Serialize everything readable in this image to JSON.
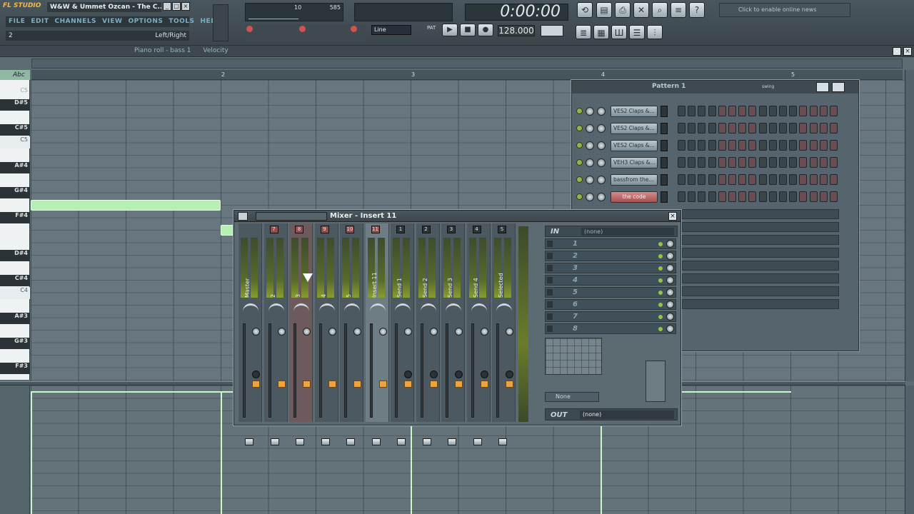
{
  "app": {
    "logo": "FL STUDIO",
    "window_title": "W&W & Ummet Ozcan - The C...",
    "menu": [
      "FILE",
      "EDIT",
      "CHANNELS",
      "VIEW",
      "OPTIONS",
      "TOOLS",
      "HELP"
    ],
    "hint_left": "2",
    "hint_right": "Left/Right",
    "cpu_num": "10",
    "mem_num": "585",
    "clock": "0:00:00",
    "tempo": "128.000",
    "pat_mode": "Line",
    "news": "Click to enable online news"
  },
  "pianoroll": {
    "title": "Piano roll - bass 1",
    "velocity_label": "Velocity",
    "keylabel": "Abc",
    "ruler": [
      "2",
      "3",
      "4",
      "5"
    ],
    "keys": [
      "C5",
      "D#5",
      "C#5",
      "C5",
      "A#4",
      "G#4",
      "F#4",
      "D#4",
      "C#4",
      "C4",
      "A#3",
      "G#3",
      "F#3"
    ]
  },
  "sequencer": {
    "title": "Pattern 1",
    "swing": "swing",
    "channels": [
      "VES2 Claps &...",
      "VES2 Claps &...",
      "VES2 Claps &...",
      "VEH3 Claps &...",
      "bassfrom the...",
      "the code"
    ]
  },
  "mixer": {
    "title": "Mixer - Insert 11",
    "in_label": "IN",
    "in_value": "(none)",
    "out_label": "OUT",
    "out_value": "(none)",
    "eq_preset": "None",
    "strips": [
      {
        "label": "Master",
        "num": ""
      },
      {
        "label": "2",
        "num": "7"
      },
      {
        "label": "3",
        "num": "8"
      },
      {
        "label": "4",
        "num": "9"
      },
      {
        "label": "5",
        "num": "10"
      },
      {
        "label": "Insert 11",
        "num": "11"
      },
      {
        "label": "Send 1",
        "num": "1"
      },
      {
        "label": "Send 2",
        "num": "2"
      },
      {
        "label": "Send 3",
        "num": "3"
      },
      {
        "label": "Send 4",
        "num": "4"
      },
      {
        "label": "Selected",
        "num": "S"
      }
    ],
    "slots": [
      "1",
      "2",
      "3",
      "4",
      "5",
      "6",
      "7",
      "8"
    ]
  }
}
